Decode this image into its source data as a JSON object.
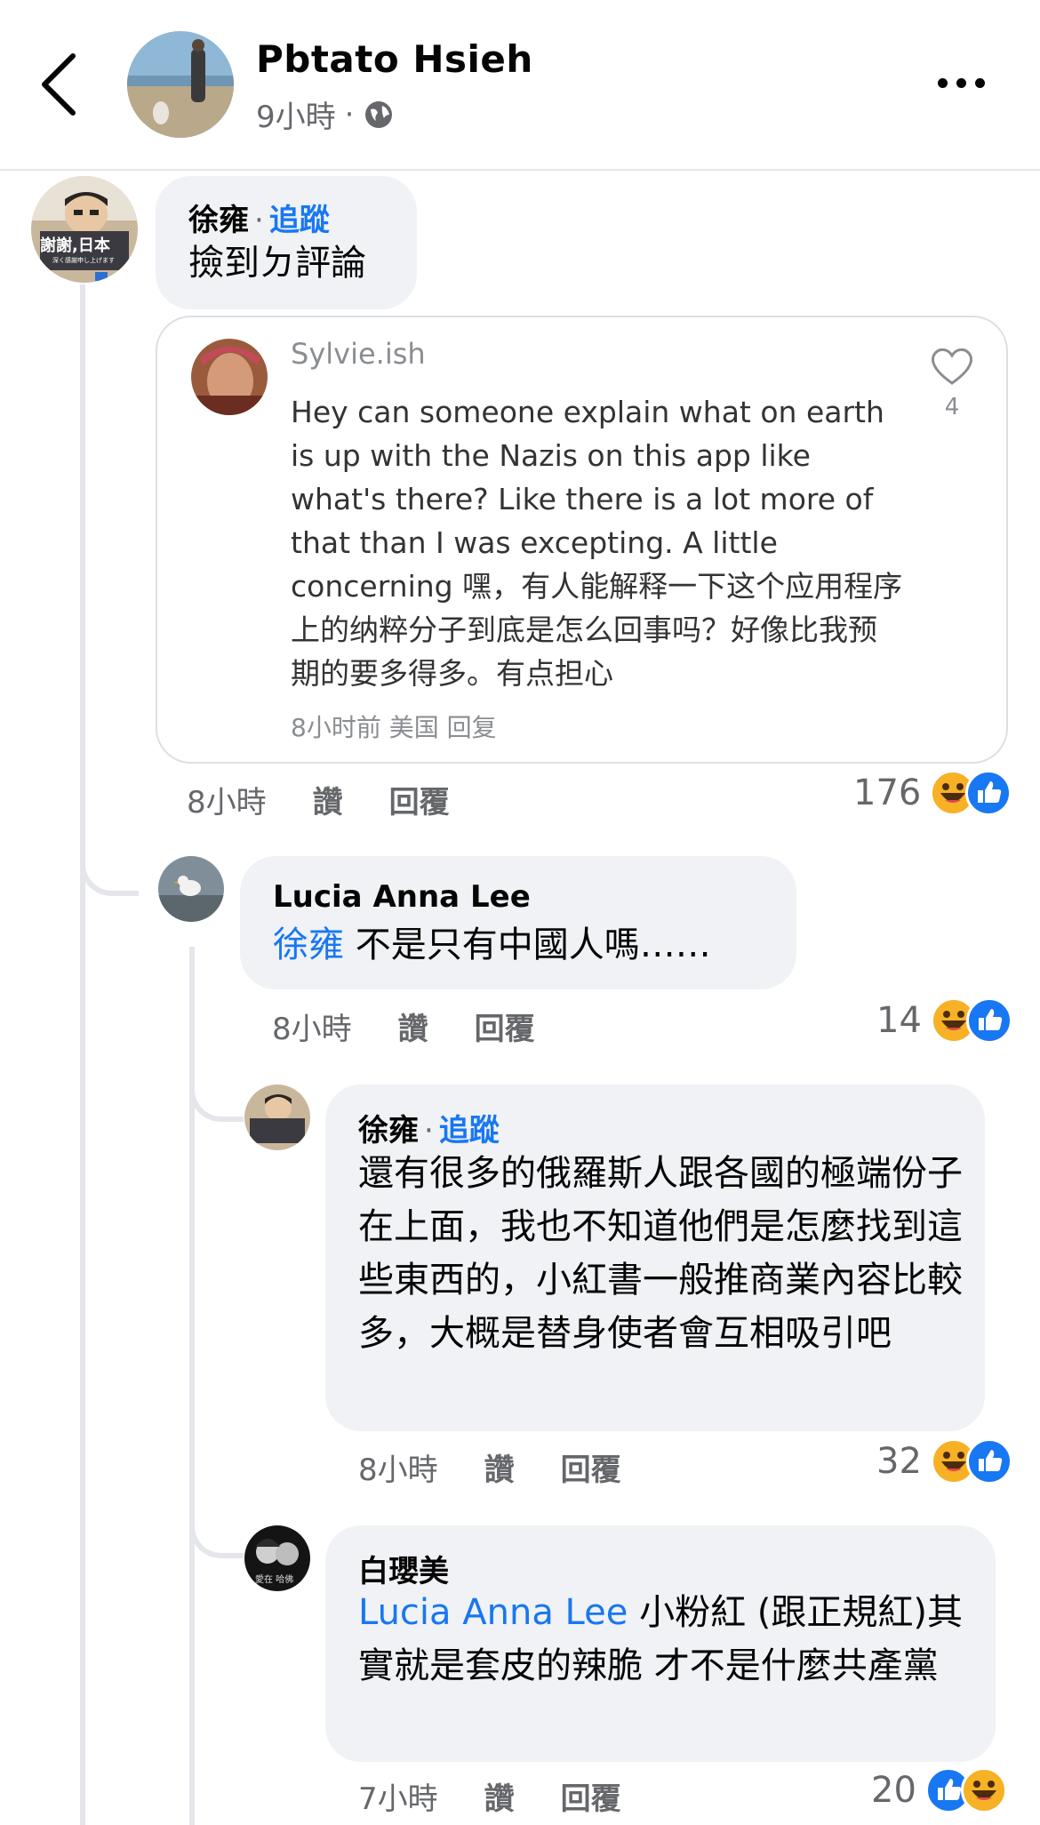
{
  "header": {
    "name": "Pbtato Hsieh",
    "time": "9小時",
    "separator": "·"
  },
  "comment1": {
    "author": "徐雍",
    "sep": "·",
    "follow": "追蹤",
    "text": "撿到ㄉ評論",
    "embedded": {
      "author": "Sylvie.ish",
      "text": "Hey can someone explain what on earth is up with the Nazis on this app like what's there? Like there is a lot more of that than I was excepting. A little concerning 嘿，有人能解释一下这个应用程序上的纳粹分子到底是怎么回事吗？好像比我预期的要多得多。有点担心",
      "footer": "8小时前  美国  回复",
      "likes": "4"
    },
    "time": "8小時",
    "like": "讚",
    "reply": "回覆",
    "count": "176"
  },
  "reply1": {
    "author": "Lucia Anna Lee",
    "mention": "徐雍",
    "text": " 不是只有中國人嗎……",
    "time": "8小時",
    "like": "讚",
    "reply": "回覆",
    "count": "14"
  },
  "reply2": {
    "author": "徐雍",
    "sep": "·",
    "follow": "追蹤",
    "text": "還有很多的俄羅斯人跟各國的極端份子在上面，我也不知道他們是怎麼找到這些東西的，小紅書一般推商業內容比較多，大概是替身使者會互相吸引吧",
    "time": "8小時",
    "like": "讚",
    "reply": "回覆",
    "count": "32"
  },
  "reply3": {
    "author": "白瓔美",
    "mention": "Lucia Anna Lee",
    "text": " 小粉紅 (跟正規紅)其實就是套皮的辣脆 才不是什麼共產黨",
    "time": "7小時",
    "like": "讚",
    "reply": "回覆",
    "count": "20"
  },
  "avatar_texts": {
    "xu_sign_line1": "謝謝,日本",
    "xu_sign_line2": "深く感謝申し上げます",
    "bai_caption": "愛在 哈佛"
  },
  "colors": {
    "link": "#1877f2",
    "bubble": "#f0f2f5",
    "muted": "#65676b",
    "haha": "#f7b125",
    "like": "#1877f2"
  }
}
